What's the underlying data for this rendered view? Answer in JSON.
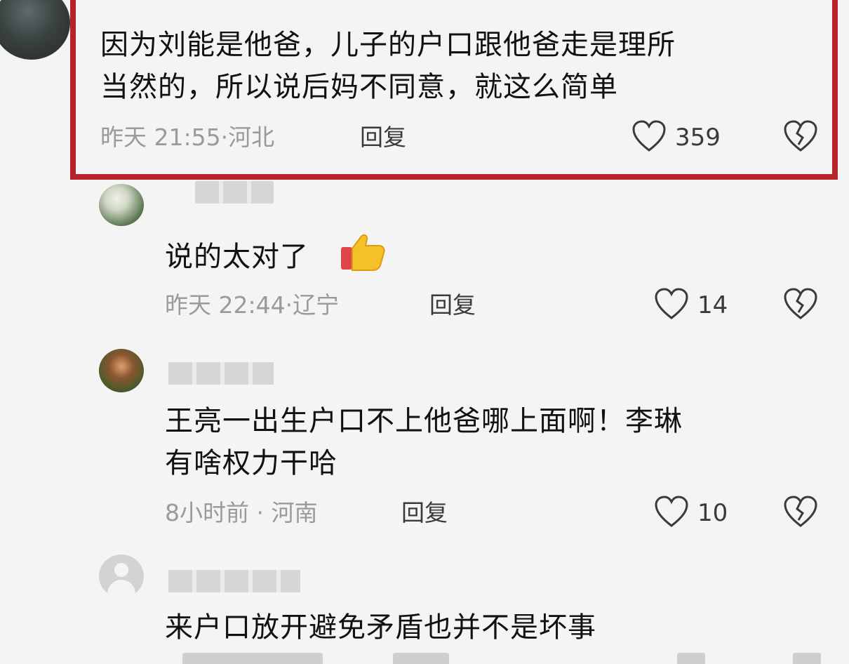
{
  "comments": [
    {
      "text": "因为刘能是他爸，儿子的户口跟他爸走是理所\n当然的，所以说后妈不同意，就这么简单",
      "time": "昨天 21:55",
      "location": "河北",
      "reply_label": "回复",
      "likes": "359",
      "highlighted": true
    }
  ],
  "replies": [
    {
      "text": "说的太对了",
      "emoji": "thumbs-up",
      "time": "昨天 22:44",
      "location": "辽宁",
      "reply_label": "回复",
      "likes": "14"
    },
    {
      "text": "王亮一出生户口不上他爸哪上面啊！李琳\n有啥权力干哈",
      "time": "8小时前",
      "location": "河南",
      "reply_label": "回复",
      "likes": "10"
    },
    {
      "text": "来户口放开避免矛盾也并不是坏事"
    }
  ],
  "colors": {
    "highlight_border": "#b6232a",
    "background": "#f4f4f4",
    "meta_text": "#9a9a9a"
  },
  "icons": {
    "like": "heart-outline-icon",
    "dislike": "broken-heart-icon"
  }
}
